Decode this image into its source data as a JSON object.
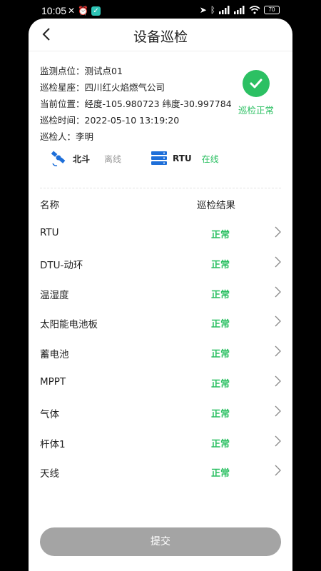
{
  "status_bar": {
    "time": "10:05",
    "battery": "70"
  },
  "header": {
    "title": "设备巡检"
  },
  "info": {
    "point": "监测点位：测试点01",
    "company": "巡检星座：四川红火焰燃气公司",
    "position": "当前位置：经度-105.980723  纬度-30.997784",
    "time": "巡检时间：2022-05-10 13:19:20",
    "inspector": "巡检人：李明"
  },
  "status": {
    "text": "巡检正常",
    "color": "#2cc063"
  },
  "connections": [
    {
      "name": "北斗",
      "state": "离线",
      "icon": "satellite-icon"
    },
    {
      "name": "RTU",
      "state": "在线",
      "icon": "server-icon"
    }
  ],
  "table": {
    "col_name": "名称",
    "col_result": "巡检结果",
    "rows": [
      {
        "name": "RTU",
        "result": "正常"
      },
      {
        "name": "DTU-动环",
        "result": "正常"
      },
      {
        "name": "温湿度",
        "result": "正常"
      },
      {
        "name": "太阳能电池板",
        "result": "正常"
      },
      {
        "name": "蓄电池",
        "result": "正常"
      },
      {
        "name": "MPPT",
        "result": "正常"
      },
      {
        "name": "气体",
        "result": "正常"
      },
      {
        "name": "杆体1",
        "result": "正常"
      },
      {
        "name": "天线",
        "result": "正常"
      }
    ]
  },
  "submit_label": "提交"
}
